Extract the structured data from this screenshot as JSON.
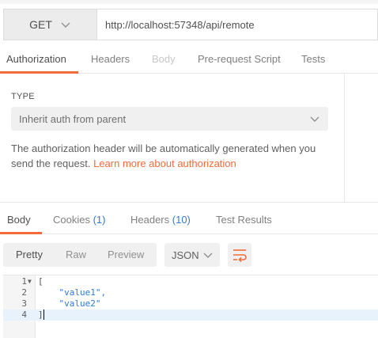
{
  "request": {
    "method": "GET",
    "url": "http://localhost:57348/api/remote"
  },
  "request_tabs": [
    {
      "label": "Authorization",
      "active": true
    },
    {
      "label": "Headers",
      "active": false
    },
    {
      "label": "Body",
      "active": false,
      "disabled": true
    },
    {
      "label": "Pre-request Script",
      "active": false
    },
    {
      "label": "Tests",
      "active": false
    }
  ],
  "auth": {
    "type_label": "TYPE",
    "selected_type": "Inherit auth from parent",
    "description": "The authorization header will be automatically generated when you send the request.",
    "learn_more": "Learn more about authorization"
  },
  "response_tabs": [
    {
      "label": "Body",
      "count": "",
      "active": true
    },
    {
      "label": "Cookies",
      "count": "(1)",
      "active": false
    },
    {
      "label": "Headers",
      "count": "(10)",
      "active": false
    },
    {
      "label": "Test Results",
      "count": "",
      "active": false
    }
  ],
  "response_toolbar": {
    "views": [
      "Pretty",
      "Raw",
      "Preview"
    ],
    "active_view": "Pretty",
    "format": "JSON",
    "wrap_icon": "wrap-lines-icon"
  },
  "response_body": {
    "line_numbers": [
      "1",
      "2",
      "3",
      "4"
    ],
    "lines": [
      "[",
      "    \"value1\",",
      "    \"value2\"",
      "]"
    ]
  },
  "colors": {
    "accent": "#f26b3a",
    "link": "#2f7bd6",
    "current_line": "#e8f2fc"
  }
}
